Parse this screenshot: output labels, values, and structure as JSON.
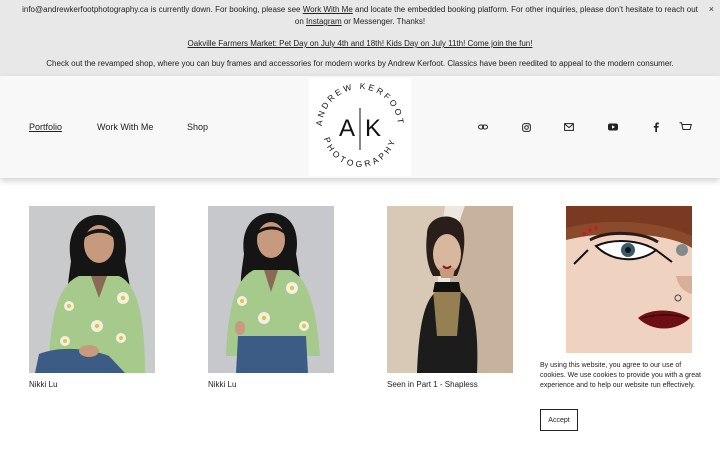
{
  "announcement": {
    "line1_pre": "info@andrewkerfootphotography.ca is currently down. For booking, please see ",
    "line1_link1": "Work With Me",
    "line1_mid": " and locate the embedded booking platform. For other inquiries, please don’t hesitate to reach out on ",
    "line1_link2": "Instagram",
    "line1_post": " or Messenger. Thanks!",
    "line2_link": "Oakville Farmers Market: Pet Day on July 4th and 18th! Kids Day on July 11th! Come join the fun!",
    "line3": "Check out the revamped shop, where you can buy frames and accessories for modern works by Andrew Kerfoot. Classics have been reedited to appeal to the modern consumer.",
    "close": "×"
  },
  "nav": {
    "items": [
      {
        "label": "Portfolio",
        "active": true
      },
      {
        "label": "Work With Me",
        "active": false
      },
      {
        "label": "Shop",
        "active": false
      }
    ]
  },
  "logo": {
    "text_top": "ANDREW KERFOOT",
    "text_bottom": "PHOTOGRAPHY",
    "left_letter": "A",
    "right_letter": "K"
  },
  "social_icons": [
    "link-icon",
    "instagram-icon",
    "email-icon",
    "youtube-icon",
    "facebook-icon",
    "cart-icon"
  ],
  "gallery": [
    {
      "caption": "Nikki Lu"
    },
    {
      "caption": "Nikki Lu"
    },
    {
      "caption": "Seen in Part 1 - Shapless"
    },
    {
      "caption": ""
    }
  ],
  "cookie": {
    "text": "By using this website, you agree to our use of cookies. We use cookies to provide you with a great experience and to help our website run effectively.",
    "accept": "Accept"
  }
}
